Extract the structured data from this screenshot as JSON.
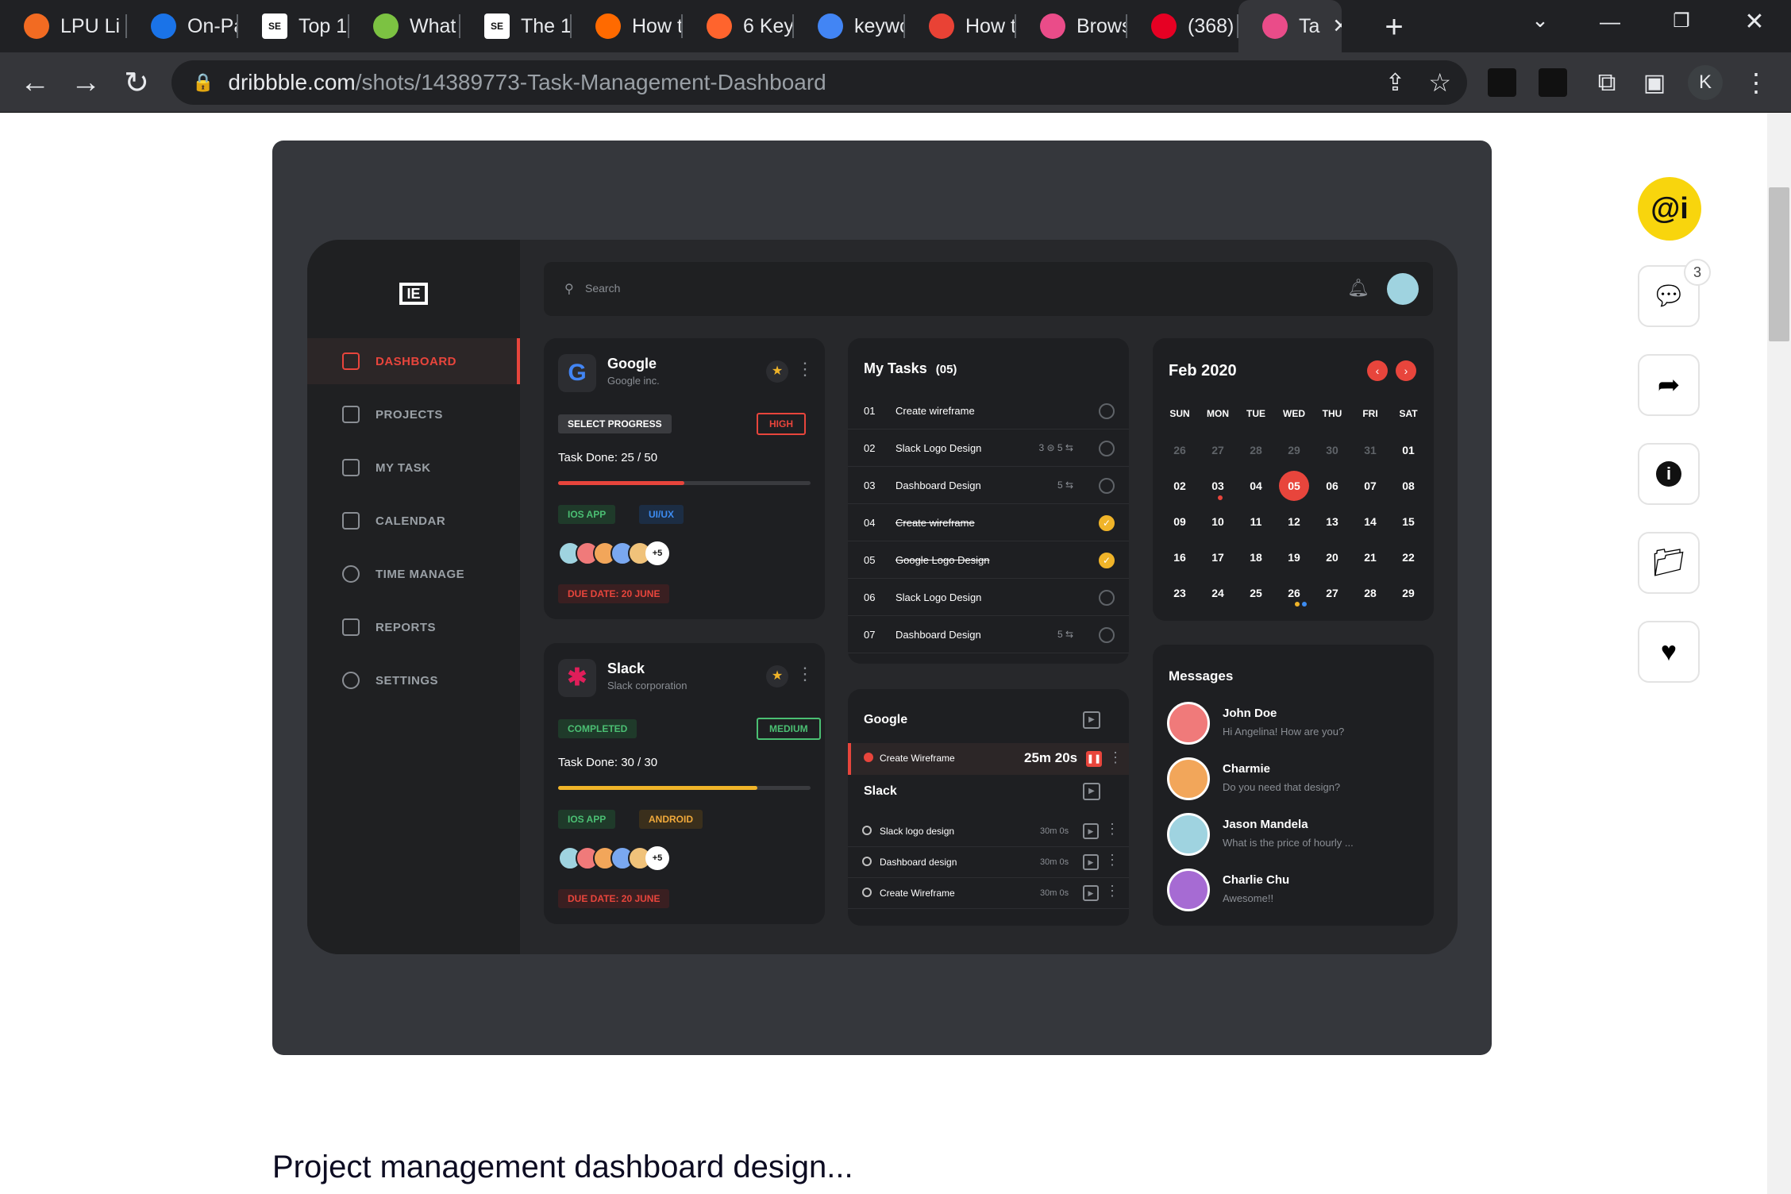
{
  "browser": {
    "tabs": [
      {
        "title": "LPU Li",
        "icon": "lpu-favicon",
        "color": "#f26b22"
      },
      {
        "title": "On-Pa",
        "icon": "check-favicon",
        "color": "#1a73e8"
      },
      {
        "title": "Top 1(",
        "icon": "sej-favicon",
        "color": "#ffffff"
      },
      {
        "title": "What",
        "icon": "grid-favicon",
        "color": "#7cc242"
      },
      {
        "title": "The 1(",
        "icon": "sej-favicon",
        "color": "#ffffff"
      },
      {
        "title": "How t",
        "icon": "a-favicon",
        "color": "#ff6a00"
      },
      {
        "title": "6 Key",
        "icon": "semrush-favicon",
        "color": "#ff642d"
      },
      {
        "title": "keywc",
        "icon": "google-favicon",
        "color": "#4285f4"
      },
      {
        "title": "How t",
        "icon": "asterisk-favicon",
        "color": "#e94235"
      },
      {
        "title": "Brows",
        "icon": "dribbble-favicon",
        "color": "#ea4c89"
      },
      {
        "title": "(368)",
        "icon": "pinterest-favicon",
        "color": "#e60023"
      },
      {
        "title": "Ta",
        "icon": "dribbble-favicon",
        "color": "#ea4c89"
      }
    ],
    "url_domain": "dribbble.com",
    "url_path": "/shots/14389773-Task-Management-Dashboard",
    "profile_initial": "K"
  },
  "dashboard": {
    "logo": "IE",
    "nav": [
      "DASHBOARD",
      "PROJECTS",
      "MY TASK",
      "CALENDAR",
      "TIME MANAGE",
      "REPORTS",
      "SETTINGS"
    ],
    "search_placeholder": "Search",
    "projects": [
      {
        "name": "Google",
        "company": "Google inc.",
        "status": "SELECT PROGRESS",
        "priority": "HIGH",
        "task_done": "Task Done: 25 / 50",
        "progress": 0.5,
        "tags": [
          "IOS APP",
          "UI/UX"
        ],
        "more": "+5",
        "due": "DUE DATE: 20 JUNE"
      },
      {
        "name": "Slack",
        "company": "Slack corporation",
        "status": "COMPLETED",
        "priority": "MEDIUM",
        "task_done": "Task Done: 30 / 30",
        "progress": 0.79,
        "tags": [
          "IOS APP",
          "ANDROID"
        ],
        "more": "+5",
        "due": "DUE DATE: 20 JUNE"
      }
    ],
    "my_tasks": {
      "title": "My Tasks",
      "count": "(05)",
      "items": [
        {
          "num": "01",
          "name": "Create wireframe",
          "meta": "",
          "done": false
        },
        {
          "num": "02",
          "name": "Slack Logo Design",
          "meta": "3 ⊜  5 ⇆",
          "done": false
        },
        {
          "num": "03",
          "name": "Dashboard Design",
          "meta": "5 ⇆",
          "done": false
        },
        {
          "num": "04",
          "name": "Create wireframe",
          "meta": "",
          "done": true
        },
        {
          "num": "05",
          "name": "Google Logo Design",
          "meta": "",
          "done": true
        },
        {
          "num": "06",
          "name": "Slack Logo Design",
          "meta": "",
          "done": false
        },
        {
          "num": "07",
          "name": "Dashboard Design",
          "meta": "5 ⇆",
          "done": false
        }
      ]
    },
    "timer": {
      "g1": "Google",
      "active_task": "Create Wireframe",
      "active_time": "25m 20s",
      "g2": "Slack",
      "items": [
        {
          "name": "Slack logo design",
          "time": "30m 0s"
        },
        {
          "name": "Dashboard design",
          "time": "30m 0s"
        },
        {
          "name": "Create Wireframe",
          "time": "30m 0s"
        }
      ]
    },
    "calendar": {
      "month": "Feb 2020",
      "days": [
        "SUN",
        "MON",
        "TUE",
        "WED",
        "THU",
        "FRI",
        "SAT"
      ],
      "weeks": [
        [
          "26",
          "27",
          "28",
          "29",
          "30",
          "31",
          "01"
        ],
        [
          "02",
          "03",
          "04",
          "05",
          "06",
          "07",
          "08"
        ],
        [
          "09",
          "10",
          "11",
          "12",
          "13",
          "14",
          "15"
        ],
        [
          "16",
          "17",
          "18",
          "19",
          "20",
          "21",
          "22"
        ],
        [
          "23",
          "24",
          "25",
          "26",
          "27",
          "28",
          "29"
        ]
      ],
      "today": "05"
    },
    "messages": {
      "title": "Messages",
      "items": [
        {
          "name": "John Doe",
          "text": "Hi Angelina! How are you?",
          "color": "#f07a7a"
        },
        {
          "name": "Charmie",
          "text": "Do you need that design?",
          "color": "#f2a65a"
        },
        {
          "name": "Jason Mandela",
          "text": "What is the price of hourly ...",
          "color": "#9fd3e0"
        },
        {
          "name": "Charlie Chu",
          "text": "Awesome!!",
          "color": "#a66bd3"
        }
      ]
    }
  },
  "page": {
    "title": "Project management dashboard design...",
    "comment_count": "3"
  }
}
